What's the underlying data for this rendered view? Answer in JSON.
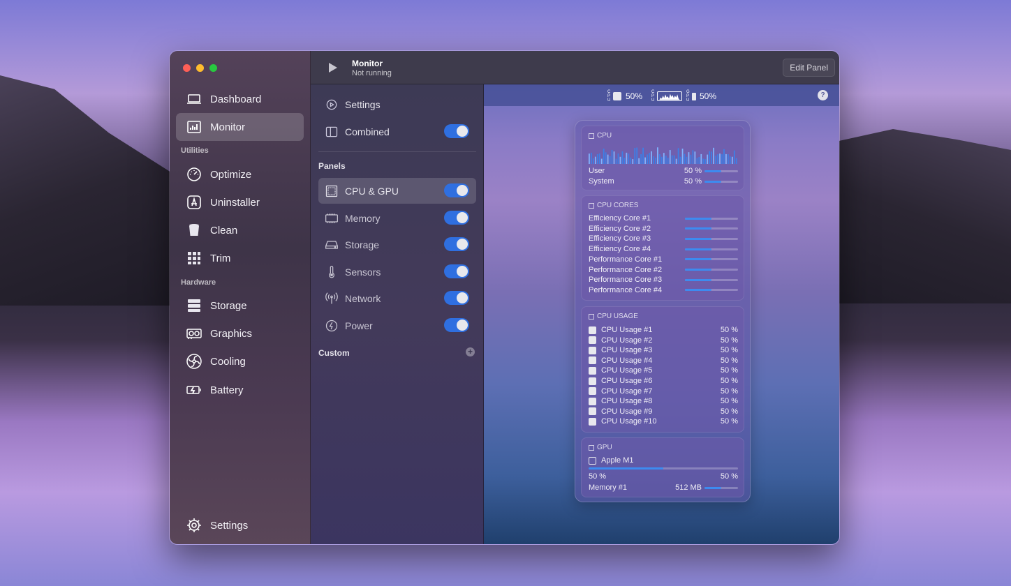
{
  "sidebar": {
    "items_top": [
      {
        "label": "Dashboard",
        "icon": "laptop-icon"
      },
      {
        "label": "Monitor",
        "icon": "bar-chart-icon",
        "active": true
      }
    ],
    "utilities_label": "Utilities",
    "utilities": [
      {
        "label": "Optimize",
        "icon": "speedometer-icon"
      },
      {
        "label": "Uninstaller",
        "icon": "app-store-icon"
      },
      {
        "label": "Clean",
        "icon": "trash-can-icon"
      },
      {
        "label": "Trim",
        "icon": "grid-icon"
      }
    ],
    "hardware_label": "Hardware",
    "hardware": [
      {
        "label": "Storage",
        "icon": "drive-stack-icon"
      },
      {
        "label": "Graphics",
        "icon": "gpu-card-icon"
      },
      {
        "label": "Cooling",
        "icon": "fan-icon"
      },
      {
        "label": "Battery",
        "icon": "battery-charging-icon"
      }
    ],
    "settings_label": "Settings"
  },
  "toolbar": {
    "title": "Monitor",
    "subtitle": "Not running",
    "edit_label": "Edit Panel"
  },
  "middle": {
    "settings_label": "Settings",
    "combined_label": "Combined",
    "panels_label": "Panels",
    "panels": [
      {
        "label": "CPU & GPU",
        "icon": "cpu-icon",
        "enabled": true
      },
      {
        "label": "Memory",
        "icon": "memory-icon",
        "enabled": true
      },
      {
        "label": "Storage",
        "icon": "drive-icon",
        "enabled": true
      },
      {
        "label": "Sensors",
        "icon": "thermometer-icon",
        "enabled": true
      },
      {
        "label": "Network",
        "icon": "antenna-icon",
        "enabled": true
      },
      {
        "label": "Power",
        "icon": "bolt-icon",
        "enabled": true
      }
    ],
    "custom_label": "Custom"
  },
  "menubar": {
    "cpu_percent": "50%",
    "gpu_percent": "50%",
    "help": "?"
  },
  "cpu": {
    "title": "CPU",
    "rows": [
      {
        "label": "User",
        "value": "50 %",
        "level": 0.5
      },
      {
        "label": "System",
        "value": "50 %",
        "level": 0.5
      }
    ]
  },
  "cores": {
    "title": "CPU CORES",
    "rows": [
      {
        "label": "Efficiency Core #1",
        "level": 0.5
      },
      {
        "label": "Efficiency Core #2",
        "level": 0.5
      },
      {
        "label": "Efficiency Core #3",
        "level": 0.5
      },
      {
        "label": "Efficiency Core #4",
        "level": 0.5
      },
      {
        "label": "Performance Core #1",
        "level": 0.5
      },
      {
        "label": "Performance Core #2",
        "level": 0.5
      },
      {
        "label": "Performance Core #3",
        "level": 0.5
      },
      {
        "label": "Performance Core #4",
        "level": 0.5
      }
    ]
  },
  "usage": {
    "title": "CPU USAGE",
    "rows": [
      {
        "label": "CPU Usage #1",
        "value": "50 %"
      },
      {
        "label": "CPU Usage #2",
        "value": "50 %"
      },
      {
        "label": "CPU Usage #3",
        "value": "50 %"
      },
      {
        "label": "CPU Usage #4",
        "value": "50 %"
      },
      {
        "label": "CPU Usage #5",
        "value": "50 %"
      },
      {
        "label": "CPU Usage #6",
        "value": "50 %"
      },
      {
        "label": "CPU Usage #7",
        "value": "50 %"
      },
      {
        "label": "CPU Usage #8",
        "value": "50 %"
      },
      {
        "label": "CPU Usage #9",
        "value": "50 %"
      },
      {
        "label": "CPU Usage #10",
        "value": "50 %"
      }
    ]
  },
  "gpu": {
    "title": "GPU",
    "device": "Apple M1",
    "usage_left": "50 %",
    "usage_right": "50 %",
    "usage_level": 0.5,
    "memory_label": "Memory #1",
    "memory_value": "512 MB",
    "memory_level": 0.5
  },
  "colors": {
    "accent": "#2f6fe0",
    "bar_fill": "#3d8bf0"
  }
}
